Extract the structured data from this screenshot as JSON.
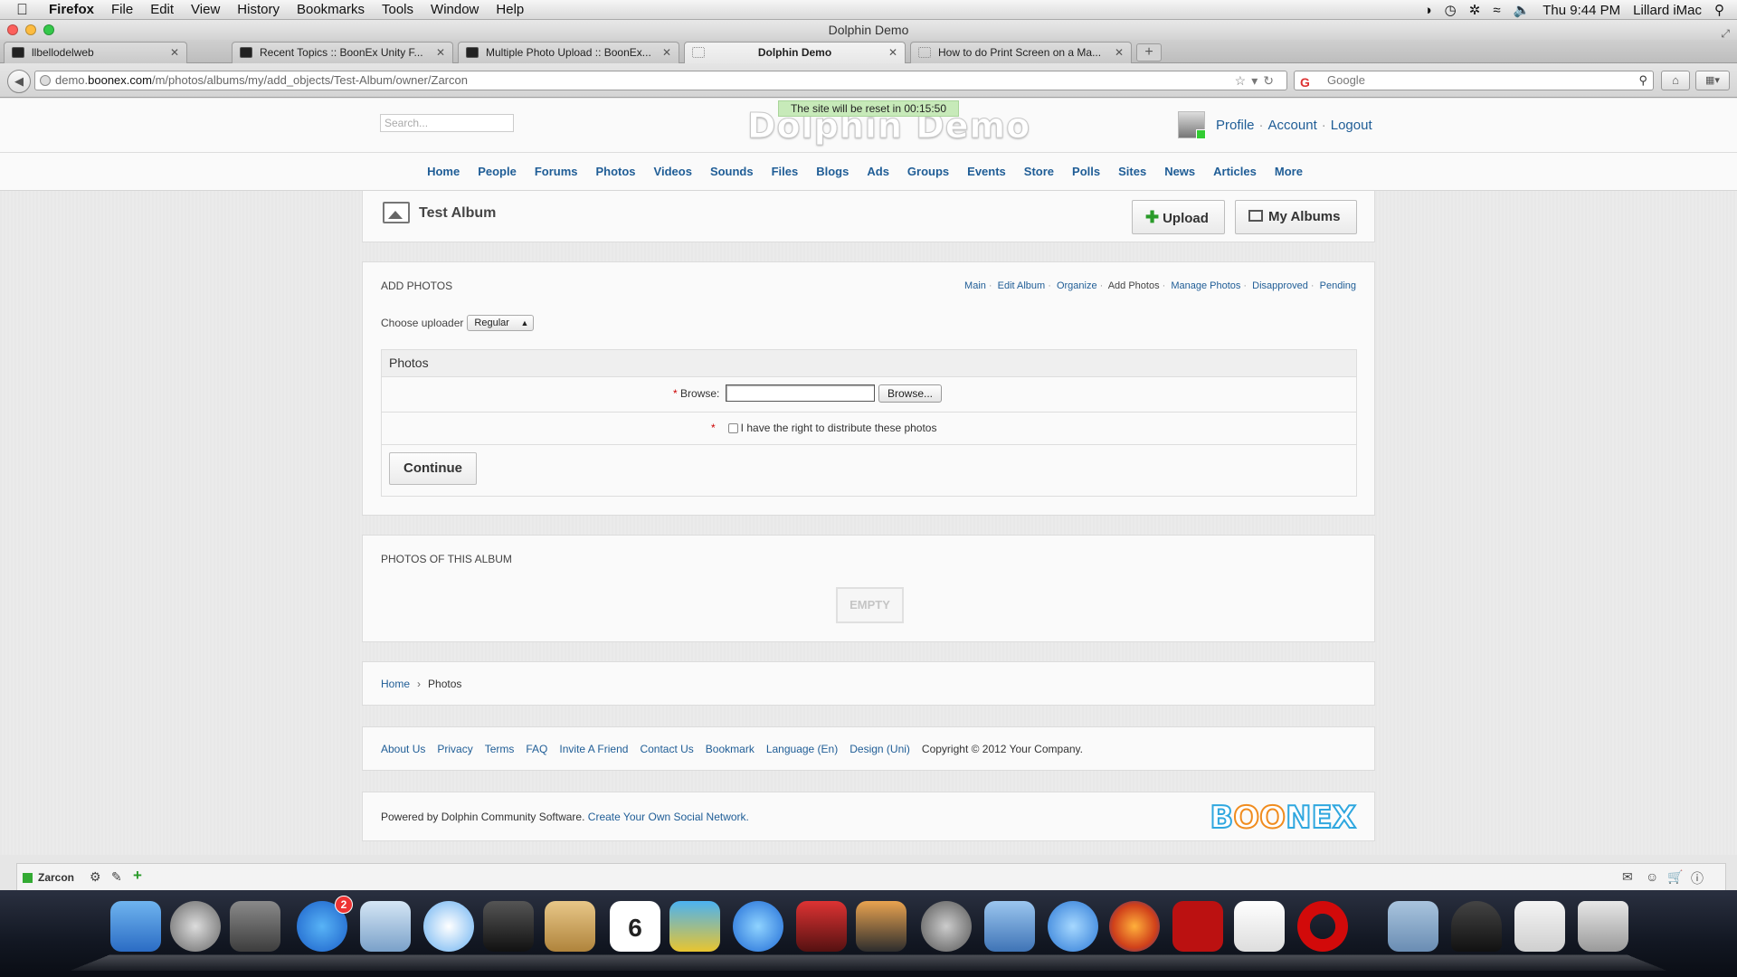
{
  "menubar": {
    "app": "Firefox",
    "items": [
      "File",
      "Edit",
      "View",
      "History",
      "Bookmarks",
      "Tools",
      "Window",
      "Help"
    ],
    "clock": "Thu 9:44 PM",
    "user": "Lillard iMac"
  },
  "window": {
    "title": "Dolphin Demo"
  },
  "tabs": [
    {
      "title": "llbellodelweb"
    },
    {
      "title": "Recent Topics :: BoonEx Unity F..."
    },
    {
      "title": "Multiple Photo Upload :: BoonEx..."
    },
    {
      "title": "Dolphin Demo"
    },
    {
      "title": "How to do Print Screen on a Ma..."
    }
  ],
  "address": {
    "domain_prefix": "demo.",
    "domain_main": "boonex.com",
    "path": "/m/photos/albums/my/add_objects/Test-Album/owner/Zarcon",
    "search_placeholder": "Google",
    "search_engine_glyph": "G"
  },
  "site": {
    "search_placeholder": "Search...",
    "reset_notice": "The site will be reset in 00:15:50",
    "logo": "Dolphin Demo",
    "user_links": [
      "Profile",
      "Account",
      "Logout"
    ],
    "nav": [
      "Home",
      "People",
      "Forums",
      "Photos",
      "Videos",
      "Sounds",
      "Files",
      "Blogs",
      "Ads",
      "Groups",
      "Events",
      "Store",
      "Polls",
      "Sites",
      "News",
      "Articles",
      "More"
    ]
  },
  "album": {
    "title": "Test Album",
    "upload_label": "Upload",
    "my_albums_label": "My Albums"
  },
  "add_photos": {
    "section_title": "ADD PHOTOS",
    "submenu": [
      {
        "label": "Main",
        "active": false
      },
      {
        "label": "Edit Album",
        "active": false
      },
      {
        "label": "Organize",
        "active": false
      },
      {
        "label": "Add Photos",
        "active": true
      },
      {
        "label": "Manage Photos",
        "active": false
      },
      {
        "label": "Disapproved",
        "active": false
      },
      {
        "label": "Pending",
        "active": false
      }
    ],
    "uploader_label": "Choose uploader",
    "uploader_value": "Regular",
    "form_title": "Photos",
    "required_mark": "*",
    "browse_label": "Browse:",
    "browse_button": "Browse...",
    "agree_label": "I have the right to distribute these photos",
    "continue_label": "Continue"
  },
  "album_photos": {
    "section_title": "PHOTOS OF THIS ALBUM",
    "empty_label": "EMPTY"
  },
  "breadcrumb": {
    "home": "Home",
    "separator": "›",
    "current": "Photos"
  },
  "footer": {
    "links": [
      "About Us",
      "Privacy",
      "Terms",
      "FAQ",
      "Invite A Friend",
      "Contact Us",
      "Bookmark",
      "Language (En)",
      "Design (Uni)"
    ],
    "copyright": "Copyright © 2012 Your Company."
  },
  "powered": {
    "text": "Powered by Dolphin Community Software.",
    "link": "Create Your Own Social Network.",
    "brand_start": "B",
    "brand_oo": "OO",
    "brand_end": "NEX"
  },
  "toolbar": {
    "username": "Zarcon"
  },
  "dock": {
    "appstore_badge": "2",
    "calendar_day": "6"
  },
  "colors": {
    "link": "#1f5d96",
    "accent_green": "#2a9b2a",
    "banner_green": "#c7eab9",
    "boonex_blue": "#2fa7df",
    "boonex_orange": "#f08c1f"
  }
}
